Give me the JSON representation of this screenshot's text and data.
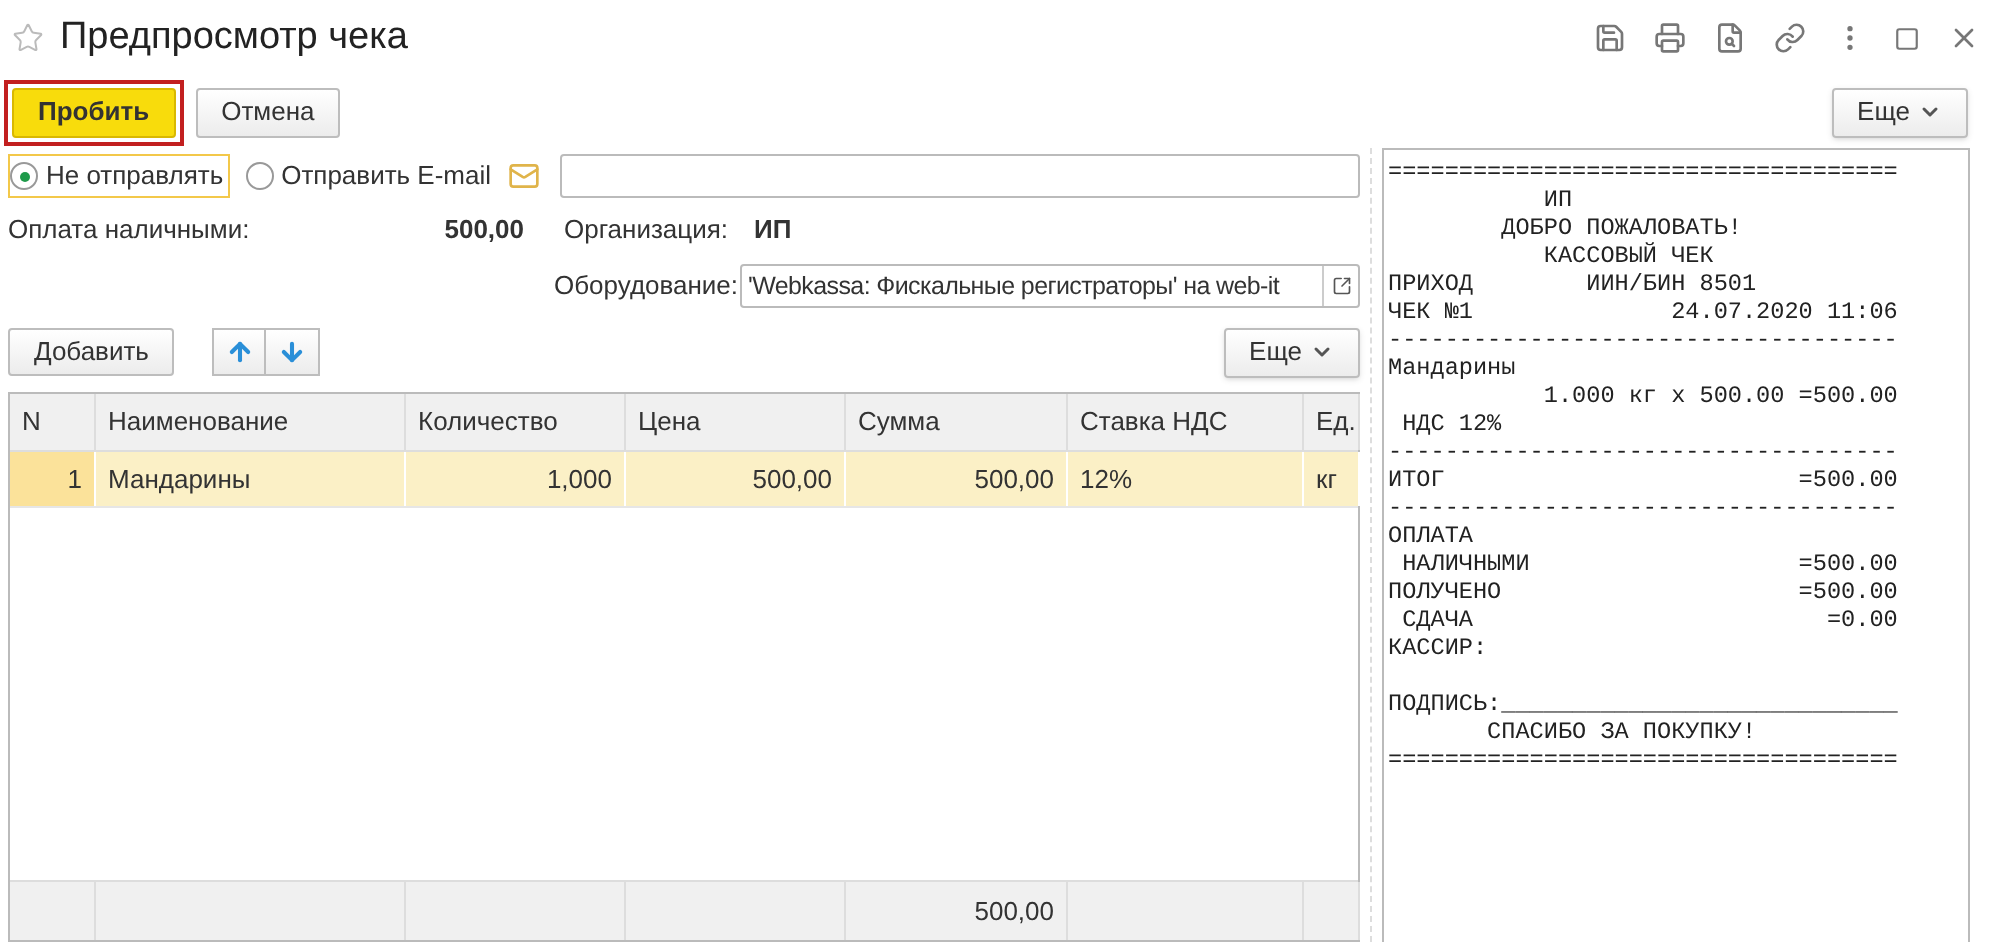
{
  "window": {
    "title": "Предпросмотр чека",
    "favorite": false
  },
  "actions": [
    {
      "label": "Пробить",
      "default": true
    },
    {
      "label": "Отмена",
      "default": false
    }
  ],
  "more_button": "Еще",
  "send_options": [
    {
      "label": "Не отправлять",
      "selected": true
    },
    {
      "label": "Отправить E-mail",
      "selected": false
    }
  ],
  "payment": {
    "label": "Оплата наличными:",
    "value": "500,00"
  },
  "organization": {
    "label": "Организация:",
    "value": "ИП"
  },
  "equipment": {
    "label": "Оборудование:",
    "value": "'Webkassa: Фискальные регистраторы' на web-it"
  },
  "table": {
    "add_button": "Добавить",
    "more_button": "Еще",
    "columns": [
      "N",
      "Наименование",
      "Количество",
      "Цена",
      "Сумма",
      "Ставка НДС",
      "Ед."
    ],
    "rows": [
      {
        "cells": [
          "1",
          "Мандарины",
          "1,000",
          "500,00",
          "500,00",
          "12%",
          "кг"
        ],
        "selected": true
      }
    ],
    "footer": {
      "sum": "500,00"
    }
  },
  "receipt": {
    "text": "====================================\n           ИП\n        ДОБРО ПОЖАЛОВАТЬ!\n           КАССОВЫЙ ЧЕК\nПРИХОД        ИИН/БИН 8501\nЧЕК №1              24.07.2020 11:06\n------------------------------------\nМандарины\n           1.000 кг x 500.00 =500.00\n НДС 12%\n------------------------------------\nИТОГ                         =500.00\n------------------------------------\nОПЛАТА\n НАЛИЧНЫМИ                   =500.00\nПОЛУЧЕНО                     =500.00\n СДАЧА                         =0.00\nКАССИР:\n\nПОДПИСЬ:____________________________\n       СПАСИБО ЗА ПОКУПКУ!\n===================================="
  }
}
